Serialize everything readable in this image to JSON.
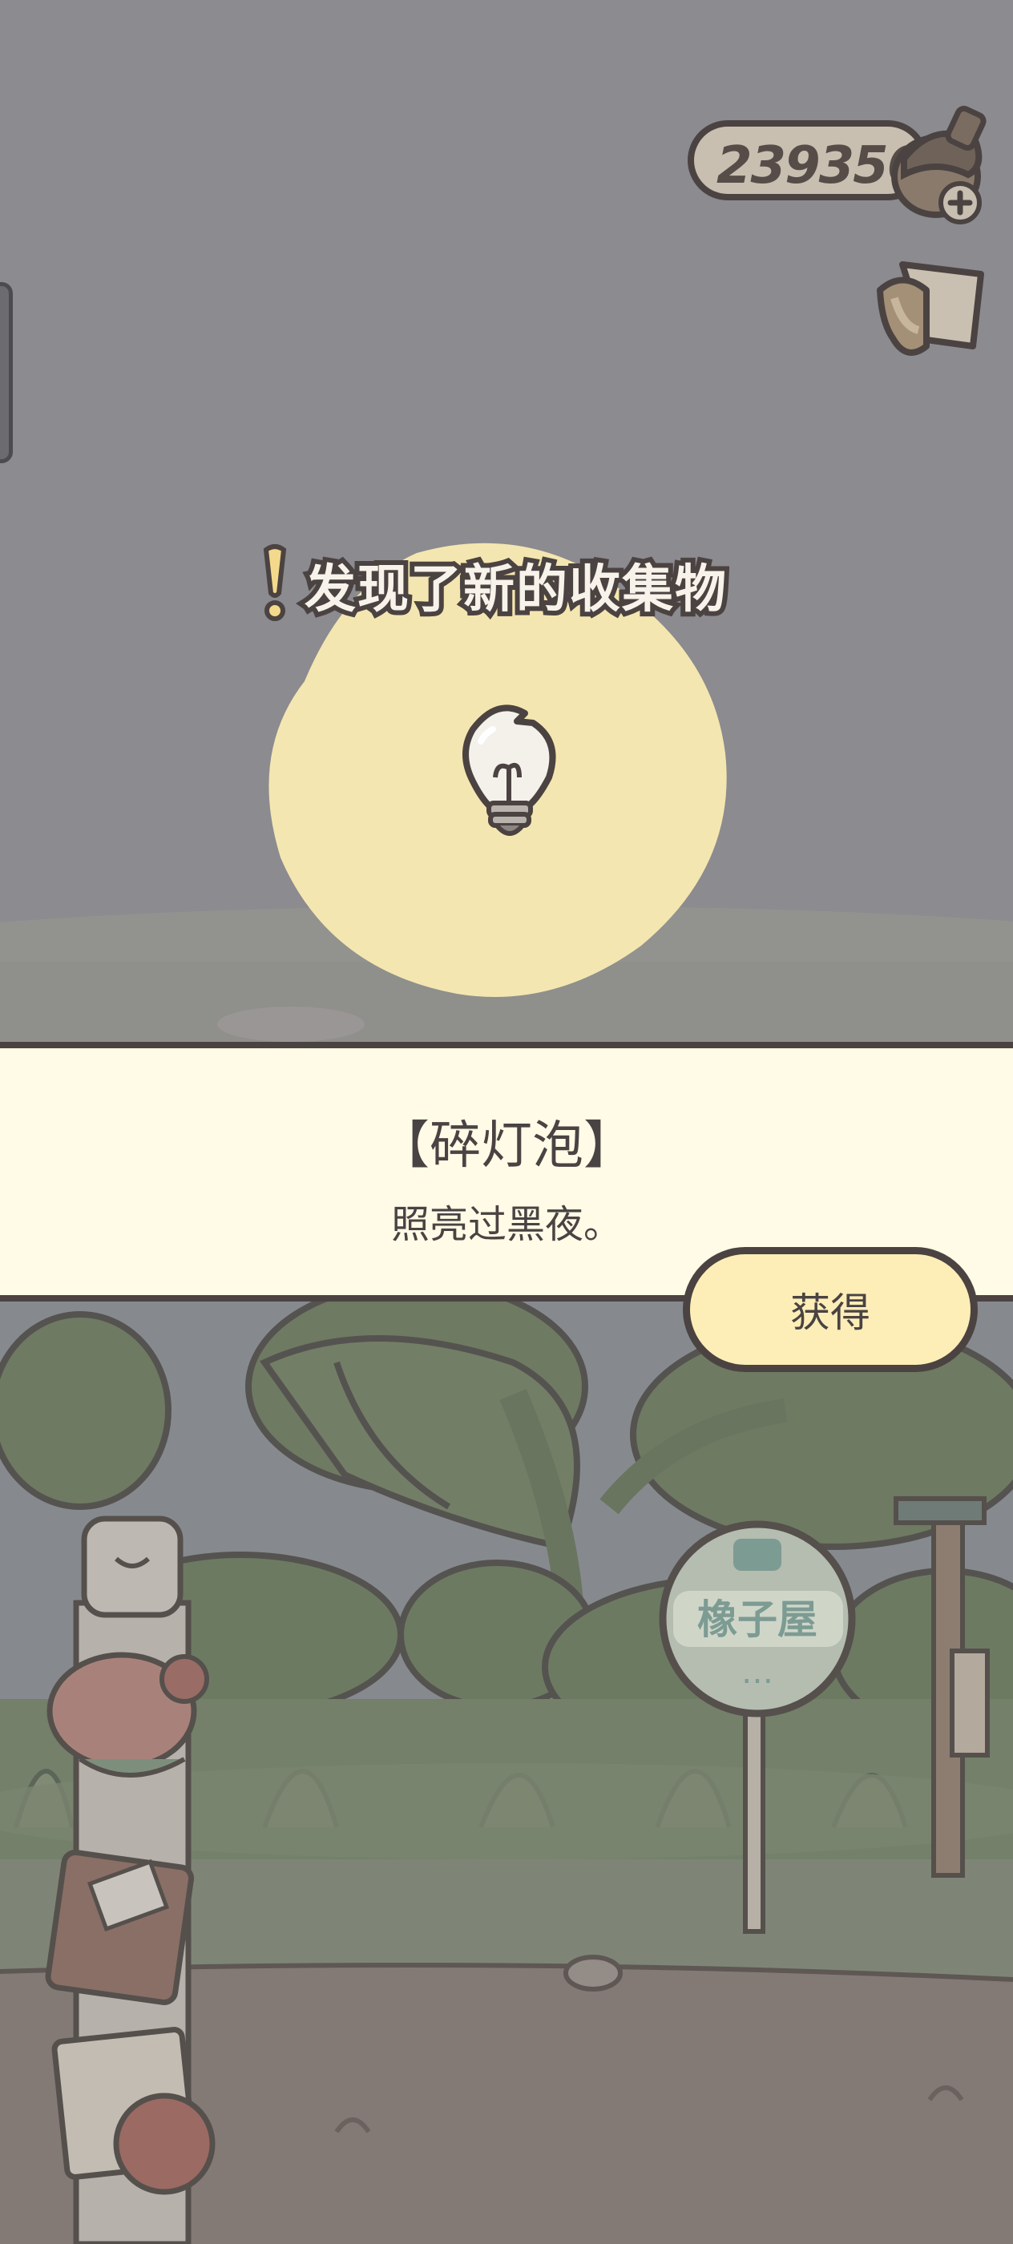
{
  "hud": {
    "currency_value": "239356",
    "currency_icon": "acorn-icon",
    "add_icon": "plus-icon",
    "menu_icon": "cup-icon"
  },
  "discovery": {
    "headline": "发现了新的收集物",
    "item_icon": "broken-lightbulb-icon"
  },
  "item": {
    "name": "【碎灯泡】",
    "description": "照亮过黑夜。"
  },
  "actions": {
    "get_label": "获得"
  },
  "scene": {
    "bus_stop_sign": "橡子屋",
    "bus_stop_dots": "…"
  },
  "colors": {
    "overlay": "#8a8a8f",
    "panel": "#fffbe6",
    "button": "#fdeeb7",
    "glow": "#f4e6b0",
    "outline": "#4b4341"
  }
}
